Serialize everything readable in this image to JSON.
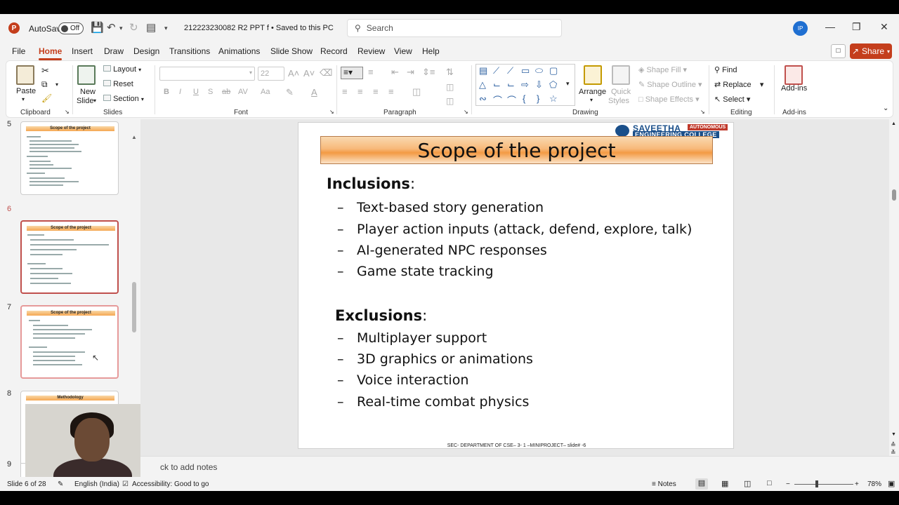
{
  "titlebar": {
    "autosave_label": "AutoSave",
    "autosave_state": "Off",
    "doc_title": "212223230082 R2 PPT f • Saved to this PC",
    "search_placeholder": "Search",
    "user_initials": "IP"
  },
  "menu": {
    "tabs": [
      "File",
      "Home",
      "Insert",
      "Draw",
      "Design",
      "Transitions",
      "Animations",
      "Slide Show",
      "Record",
      "Review",
      "View",
      "Help"
    ],
    "active": "Home",
    "share_label": "Share"
  },
  "ribbon": {
    "clipboard": {
      "paste": "Paste",
      "label": "Clipboard"
    },
    "slides": {
      "new_slide_1": "New",
      "new_slide_2": "Slide",
      "layout": "Layout",
      "reset": "Reset",
      "section": "Section",
      "label": "Slides"
    },
    "font": {
      "size": "22",
      "label": "Font"
    },
    "paragraph": {
      "label": "Paragraph"
    },
    "drawing": {
      "arrange": "Arrange",
      "quick_styles_1": "Quick",
      "quick_styles_2": "Styles",
      "shape_fill": "Shape Fill",
      "shape_outline": "Shape Outline",
      "shape_effects": "Shape Effects",
      "label": "Drawing"
    },
    "editing": {
      "find": "Find",
      "replace": "Replace",
      "select": "Select",
      "label": "Editing"
    },
    "addins": {
      "addins": "Add-ins",
      "label": "Add-ins"
    }
  },
  "thumbnails": [
    {
      "num": "5",
      "title": "Scope of the project"
    },
    {
      "num": "6",
      "title": "Scope of the project"
    },
    {
      "num": "7",
      "title": "Scope of the project"
    },
    {
      "num": "8",
      "title": "Methodology"
    },
    {
      "num": "9"
    }
  ],
  "slide": {
    "college_name_1": "SAVEETHA",
    "college_autonomous": "AUTONOMOUS",
    "college_name_2": "ENGINEERING COLLEGE",
    "title": "Scope of the project",
    "inclusions_heading": "Inclusions",
    "inclusions": [
      "Text-based story generation",
      "Player action inputs (attack, defend, explore, talk)",
      "AI-generated NPC responses",
      "Game state tracking"
    ],
    "exclusions_heading": "Exclusions",
    "exclusions": [
      "Multiplayer support",
      "3D graphics or animations",
      "Voice interaction",
      "Real-time combat physics"
    ],
    "footer": "SEC- DEPARTMENT OF CSE– 3- 1 –MINIPROJECT– slide# -6"
  },
  "notes_placeholder": "ck to add notes",
  "status": {
    "slide_info": "Slide 6 of 28",
    "language": "English (India)",
    "accessibility": "Accessibility: Good to go",
    "notes": "Notes",
    "zoom": "78%"
  },
  "colors": {
    "accent": "#c43e1c",
    "college_blue": "#1a4f8a"
  }
}
